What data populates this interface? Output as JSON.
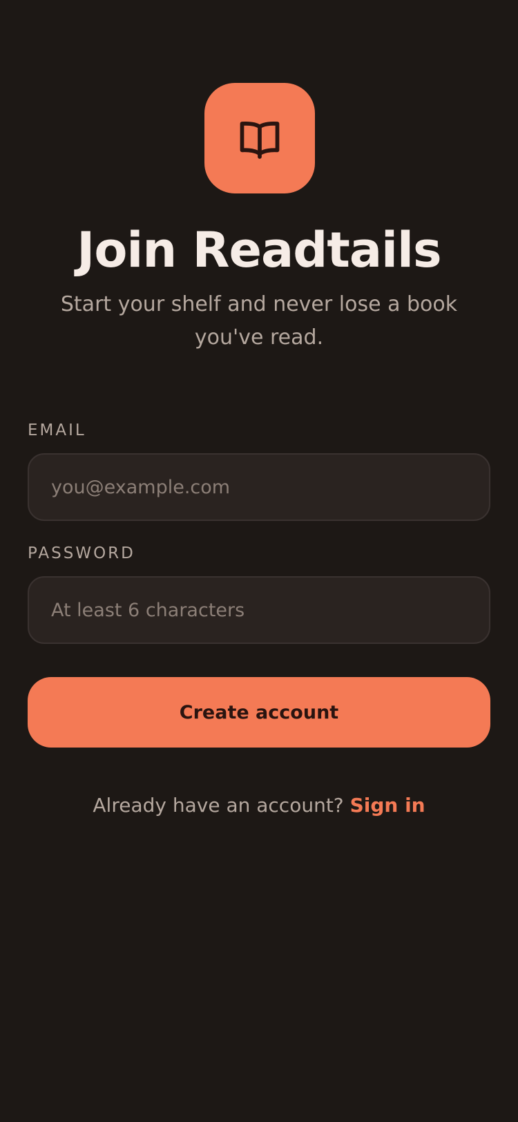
{
  "brand": {
    "logo_icon": "open-book-icon",
    "accent_color": "#f47a55",
    "background_color": "#1d1815"
  },
  "header": {
    "title": "Join Readtails",
    "subtitle": "Start your shelf and never lose a book you've read."
  },
  "form": {
    "email_label": "EMAIL",
    "email_placeholder": "you@example.com",
    "email_value": "",
    "password_label": "PASSWORD",
    "password_placeholder": "At least 6 characters",
    "password_value": "",
    "submit_label": "Create account"
  },
  "footer": {
    "prompt": "Already have an account?",
    "signin_label": "Sign in"
  }
}
